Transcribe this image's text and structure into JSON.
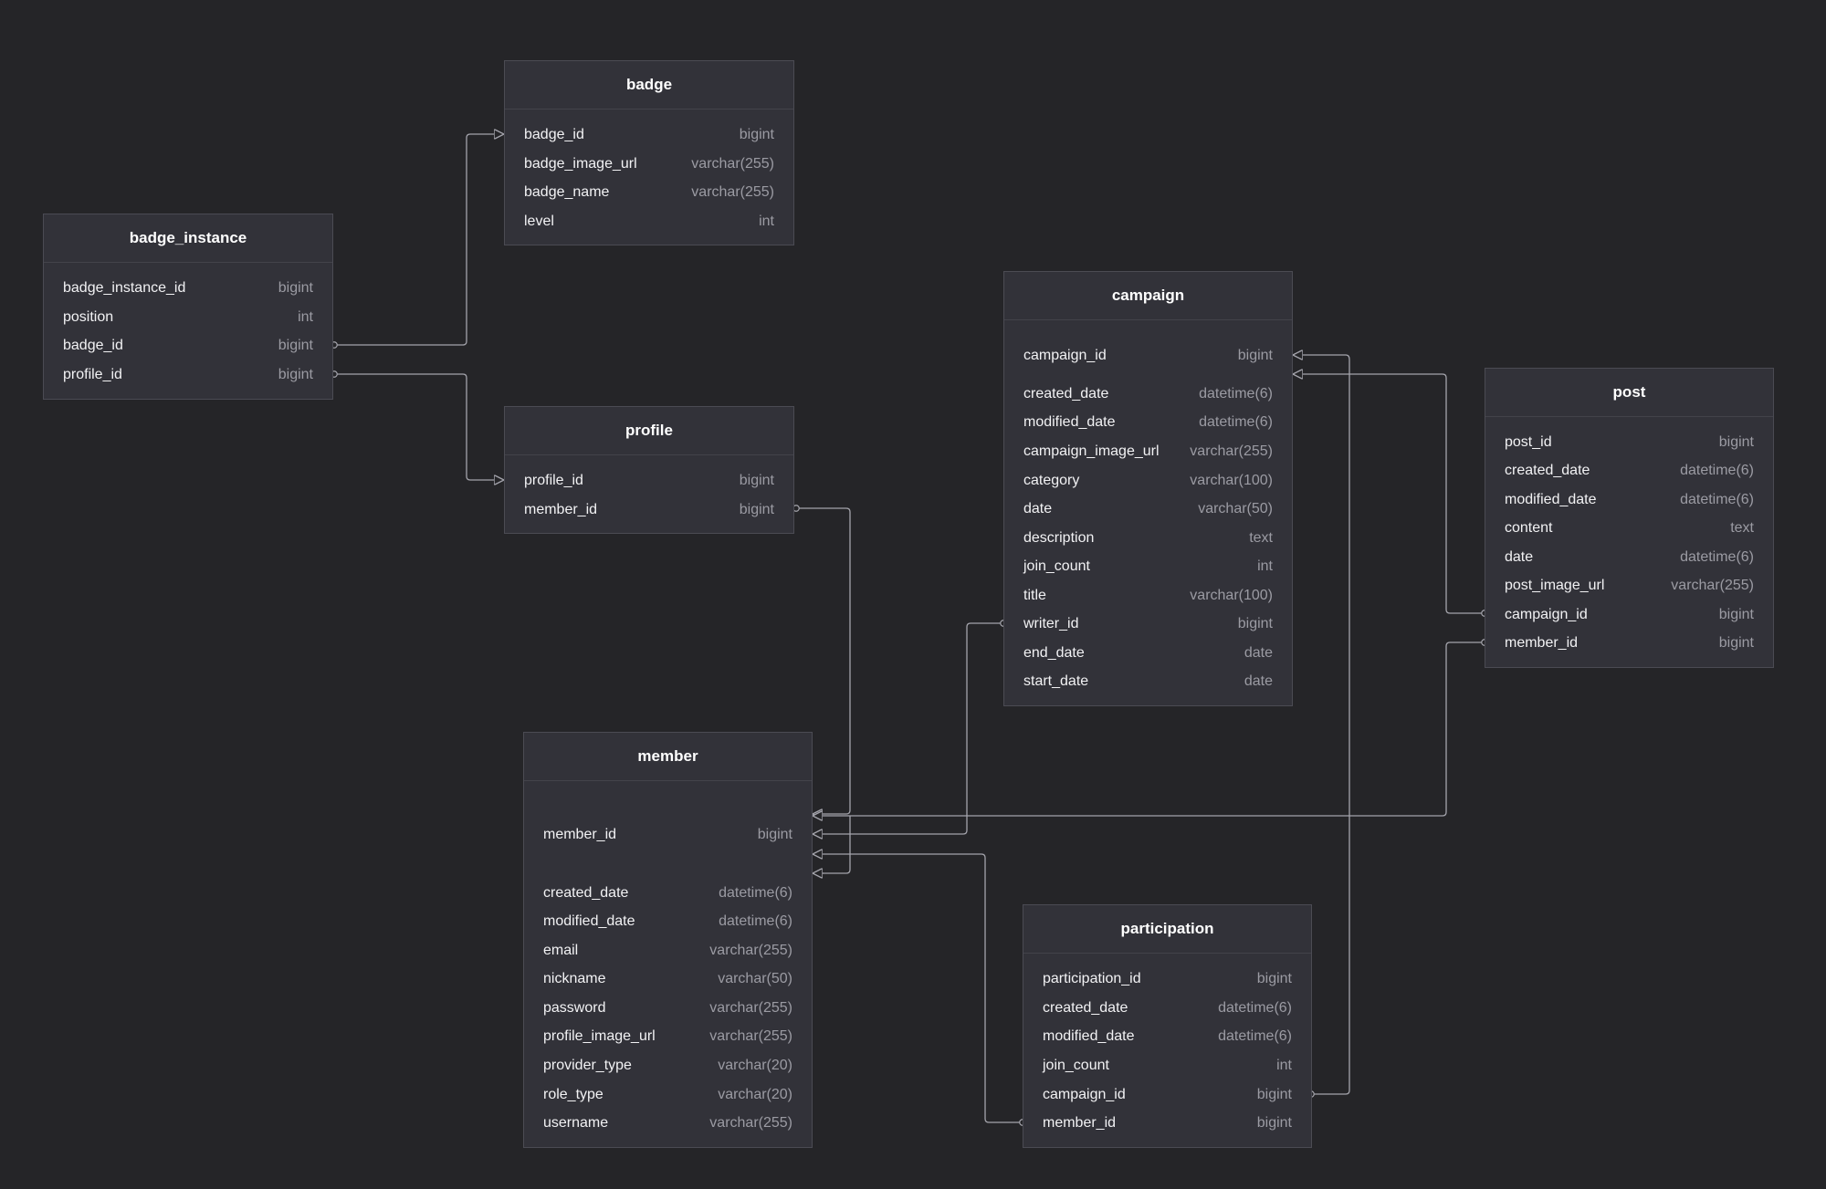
{
  "tables": {
    "badge": {
      "name": "badge",
      "columns": [
        {
          "name": "badge_id",
          "type": "bigint"
        },
        {
          "name": "badge_image_url",
          "type": "varchar(255)"
        },
        {
          "name": "badge_name",
          "type": "varchar(255)"
        },
        {
          "name": "level",
          "type": "int"
        }
      ]
    },
    "badge_instance": {
      "name": "badge_instance",
      "columns": [
        {
          "name": "badge_instance_id",
          "type": "bigint"
        },
        {
          "name": "position",
          "type": "int"
        },
        {
          "name": "badge_id",
          "type": "bigint"
        },
        {
          "name": "profile_id",
          "type": "bigint"
        }
      ]
    },
    "profile": {
      "name": "profile",
      "columns": [
        {
          "name": "profile_id",
          "type": "bigint"
        },
        {
          "name": "member_id",
          "type": "bigint"
        }
      ]
    },
    "campaign": {
      "name": "campaign",
      "columns": [
        {
          "name": "campaign_id",
          "type": "bigint"
        },
        {
          "name": "created_date",
          "type": "datetime(6)"
        },
        {
          "name": "modified_date",
          "type": "datetime(6)"
        },
        {
          "name": "campaign_image_url",
          "type": "varchar(255)"
        },
        {
          "name": "category",
          "type": "varchar(100)"
        },
        {
          "name": "date",
          "type": "varchar(50)"
        },
        {
          "name": "description",
          "type": "text"
        },
        {
          "name": "join_count",
          "type": "int"
        },
        {
          "name": "title",
          "type": "varchar(100)"
        },
        {
          "name": "writer_id",
          "type": "bigint"
        },
        {
          "name": "end_date",
          "type": "date"
        },
        {
          "name": "start_date",
          "type": "date"
        }
      ]
    },
    "post": {
      "name": "post",
      "columns": [
        {
          "name": "post_id",
          "type": "bigint"
        },
        {
          "name": "created_date",
          "type": "datetime(6)"
        },
        {
          "name": "modified_date",
          "type": "datetime(6)"
        },
        {
          "name": "content",
          "type": "text"
        },
        {
          "name": "date",
          "type": "datetime(6)"
        },
        {
          "name": "post_image_url",
          "type": "varchar(255)"
        },
        {
          "name": "campaign_id",
          "type": "bigint"
        },
        {
          "name": "member_id",
          "type": "bigint"
        }
      ]
    },
    "member": {
      "name": "member",
      "columns": [
        {
          "name": "member_id",
          "type": "bigint"
        },
        {
          "name": "created_date",
          "type": "datetime(6)"
        },
        {
          "name": "modified_date",
          "type": "datetime(6)"
        },
        {
          "name": "email",
          "type": "varchar(255)"
        },
        {
          "name": "nickname",
          "type": "varchar(50)"
        },
        {
          "name": "password",
          "type": "varchar(255)"
        },
        {
          "name": "profile_image_url",
          "type": "varchar(255)"
        },
        {
          "name": "provider_type",
          "type": "varchar(20)"
        },
        {
          "name": "role_type",
          "type": "varchar(20)"
        },
        {
          "name": "username",
          "type": "varchar(255)"
        }
      ]
    },
    "participation": {
      "name": "participation",
      "columns": [
        {
          "name": "participation_id",
          "type": "bigint"
        },
        {
          "name": "created_date",
          "type": "datetime(6)"
        },
        {
          "name": "modified_date",
          "type": "datetime(6)"
        },
        {
          "name": "join_count",
          "type": "int"
        },
        {
          "name": "campaign_id",
          "type": "bigint"
        },
        {
          "name": "member_id",
          "type": "bigint"
        }
      ]
    }
  },
  "relationships": [
    {
      "from": "badge_instance.badge_id",
      "to": "badge.badge_id"
    },
    {
      "from": "badge_instance.profile_id",
      "to": "profile.profile_id"
    },
    {
      "from": "profile.member_id",
      "to": "member.member_id"
    },
    {
      "from": "campaign.writer_id",
      "to": "member.member_id"
    },
    {
      "from": "post.member_id",
      "to": "member.member_id"
    },
    {
      "from": "post.campaign_id",
      "to": "campaign.campaign_id"
    },
    {
      "from": "participation.campaign_id",
      "to": "campaign.campaign_id"
    },
    {
      "from": "participation.member_id",
      "to": "member.member_id"
    }
  ],
  "colors": {
    "background": "#252528",
    "table_fill": "#323239",
    "table_border": "#4b4b53",
    "connector": "#a4a4ac"
  }
}
